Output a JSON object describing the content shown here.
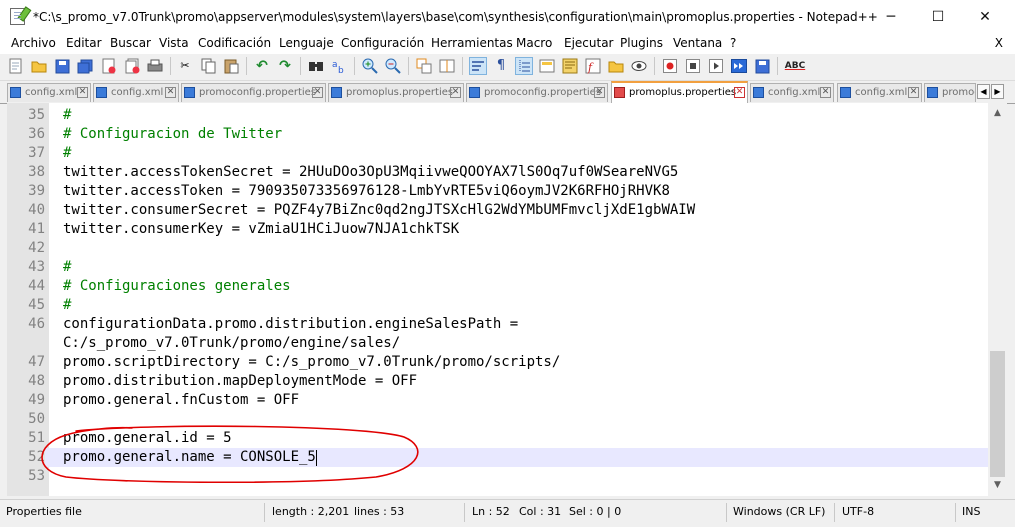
{
  "window": {
    "title": "*C:\\s_promo_v7.0Trunk\\promo\\appserver\\modules\\system\\layers\\base\\com\\synthesis\\configuration\\main\\promoplus.properties - Notepad++",
    "minimize": "─",
    "maximize": "☐",
    "close": "✕"
  },
  "menu": {
    "items": [
      "Archivo",
      "Editar",
      "Buscar",
      "Vista",
      "Codificación",
      "Lenguaje",
      "Configuración",
      "Herramientas",
      "Macro",
      "Ejecutar",
      "Plugins",
      "Ventana",
      "?"
    ],
    "close_doc": "X"
  },
  "toolbar": {
    "icons": [
      "new-file-icon",
      "open-file-icon",
      "save-icon",
      "save-all-icon",
      "close-icon",
      "close-all-icon",
      "print-icon",
      "cut-icon",
      "copy-icon",
      "paste-icon",
      "undo-icon",
      "redo-icon",
      "find-icon",
      "replace-icon",
      "zoom-in-icon",
      "zoom-out-icon",
      "sync-vertical-icon",
      "sync-horizontal-icon",
      "word-wrap-icon",
      "show-all-chars-icon",
      "indent-guide-icon",
      "udl-icon",
      "doc-map-icon",
      "function-list-icon",
      "folder-workspace-icon",
      "monitoring-icon",
      "record-macro-icon",
      "stop-macro-icon",
      "play-macro-icon",
      "run-macro-multiple-icon",
      "save-macro-icon",
      "spellcheck-icon"
    ],
    "spellcheck_label": "ABC"
  },
  "tabs": [
    {
      "label": "config.xml",
      "active": false
    },
    {
      "label": "config.xml",
      "active": false
    },
    {
      "label": "promoconfig.properties",
      "active": false
    },
    {
      "label": "promoplus.properties",
      "active": false
    },
    {
      "label": "promoconfig.properties",
      "active": false
    },
    {
      "label": "promoplus.properties",
      "active": true
    },
    {
      "label": "config.xml",
      "active": false
    },
    {
      "label": "config.xml",
      "active": false
    },
    {
      "label": "promoc",
      "active": false
    }
  ],
  "tab_scroll": {
    "left": "◀",
    "right": "▶"
  },
  "editor": {
    "lines": [
      {
        "num": "35",
        "text": "#",
        "type": "comment"
      },
      {
        "num": "36",
        "text": "# Configuracion de Twitter",
        "type": "comment"
      },
      {
        "num": "37",
        "text": "#",
        "type": "comment"
      },
      {
        "num": "38",
        "text": "twitter.accessTokenSecret = 2HUuDOo3OpU3MqiivweQOOYAX7lS0Oq7uf0WSeareNVG5",
        "type": "code"
      },
      {
        "num": "39",
        "text": "twitter.accessToken = 790935073356976128-LmbYvRTE5viQ6oymJV2K6RFHOjRHVK8",
        "type": "code"
      },
      {
        "num": "40",
        "text": "twitter.consumerSecret = PQZF4y7BiZnc0qd2ngJTSXcHlG2WdYMbUMFmvcljXdE1gbWAIW",
        "type": "code"
      },
      {
        "num": "41",
        "text": "twitter.consumerKey = vZmiaU1HCiJuow7NJA1chkTSK",
        "type": "code"
      },
      {
        "num": "42",
        "text": "",
        "type": "code"
      },
      {
        "num": "43",
        "text": "#",
        "type": "comment"
      },
      {
        "num": "44",
        "text": "# Configuraciones generales",
        "type": "comment"
      },
      {
        "num": "45",
        "text": "#",
        "type": "comment"
      },
      {
        "num": "46",
        "text": "configurationData.promo.distribution.engineSalesPath =",
        "type": "code"
      },
      {
        "num": "",
        "text": "C:/s_promo_v7.0Trunk/promo/engine/sales/",
        "type": "code"
      },
      {
        "num": "47",
        "text": "promo.scriptDirectory = C:/s_promo_v7.0Trunk/promo/scripts/",
        "type": "code"
      },
      {
        "num": "48",
        "text": "promo.distribution.mapDeploymentMode = OFF",
        "type": "code"
      },
      {
        "num": "49",
        "text": "promo.general.fnCustom = OFF",
        "type": "code"
      },
      {
        "num": "50",
        "text": "",
        "type": "code"
      },
      {
        "num": "51",
        "text": "promo.general.id = 5",
        "type": "code"
      },
      {
        "num": "52",
        "text": "promo.general.name = CONSOLE_5",
        "type": "code",
        "current": true
      },
      {
        "num": "53",
        "text": "",
        "type": "code"
      }
    ]
  },
  "scrollbar": {
    "up": "▲",
    "down": "▼"
  },
  "status": {
    "filetype": "Properties file",
    "length": "length : 2,201",
    "lines": "lines : 53",
    "ln": "Ln : 52",
    "col": "Col : 31",
    "sel": "Sel : 0 | 0",
    "eol": "Windows (CR LF)",
    "encoding": "UTF-8",
    "mode": "INS"
  },
  "colors": {
    "comment": "#008000",
    "annotation": "#e00000",
    "current_line": "#e8e8ff",
    "active_tab_accent": "#f2a040"
  }
}
